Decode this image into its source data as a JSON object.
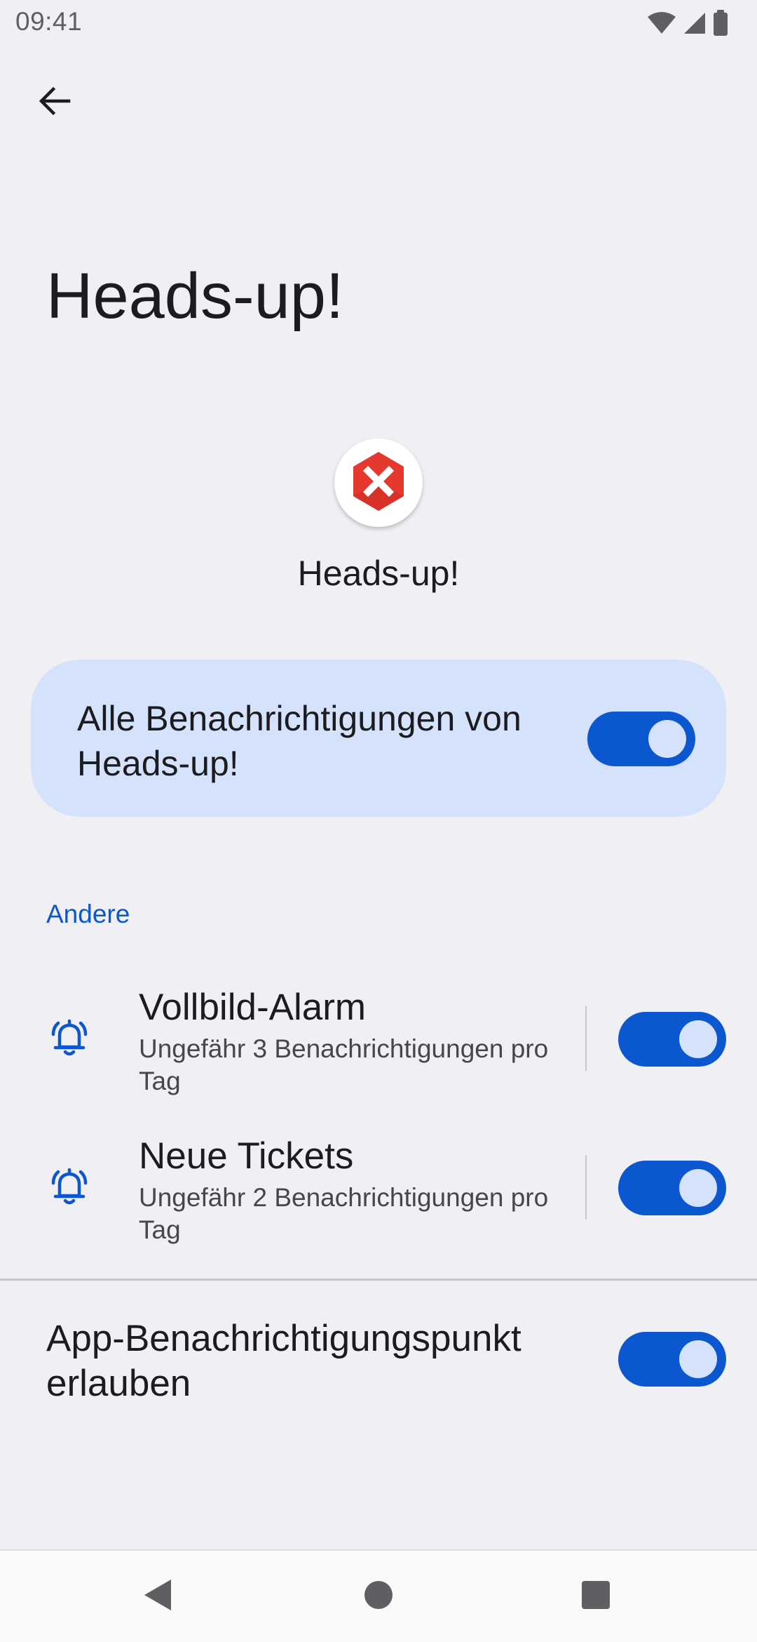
{
  "status_bar": {
    "time": "09:41",
    "icons": [
      "wifi-icon",
      "signal-icon",
      "battery-icon"
    ]
  },
  "header": {
    "back_icon": "arrow-back-icon",
    "title": "Heads-up!"
  },
  "app": {
    "icon": "app-error-hexagon-icon",
    "name": "Heads-up!"
  },
  "master_toggle": {
    "label": "Alle Benachrichtigungen von Heads-up!",
    "enabled": true
  },
  "section": {
    "title": "Andere"
  },
  "channels": [
    {
      "icon": "bell-ring-icon",
      "title": "Vollbild-Alarm",
      "subtitle": "Ungefähr 3 Benachrichtigungen pro Tag",
      "enabled": true
    },
    {
      "icon": "bell-ring-icon",
      "title": "Neue Tickets",
      "subtitle": "Ungefähr 2 Benachrichtigungen pro Tag",
      "enabled": true
    }
  ],
  "notification_dot": {
    "label": "App-Benachrichtigungspunkt erlauben",
    "enabled": true
  },
  "nav_bar": {
    "buttons": [
      "back-triangle-icon",
      "home-circle-icon",
      "recents-square-icon"
    ]
  },
  "colors": {
    "accent": "#0b57d0",
    "card_bg": "#d4e2fb",
    "background": "#f0eff3",
    "app_icon_red": "#e5382f"
  }
}
